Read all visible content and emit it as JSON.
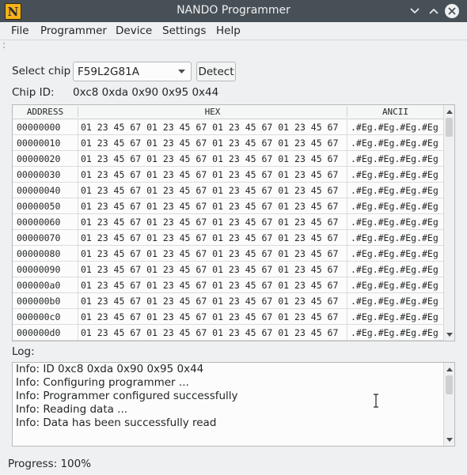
{
  "window": {
    "title": "NANDO Programmer",
    "app_icon_letter": "N"
  },
  "menu": [
    "File",
    "Programmer",
    "Device",
    "Settings",
    "Help"
  ],
  "chip_select": {
    "label": "Select chip",
    "value": "F59L2G81A",
    "detect_label": "Detect"
  },
  "chip_id": {
    "label": "Chip ID:",
    "value": "0xc8 0xda 0x90 0x95 0x44"
  },
  "hex_table": {
    "headers": [
      "ADDRESS",
      "HEX",
      "ANCII"
    ],
    "rows": [
      {
        "address": "00000000",
        "hex": "01 23 45 67 01 23 45 67 01 23 45 67 01 23 45 67",
        "ascii": ".#Eg.#Eg.#Eg.#Eg"
      },
      {
        "address": "00000010",
        "hex": "01 23 45 67 01 23 45 67 01 23 45 67 01 23 45 67",
        "ascii": ".#Eg.#Eg.#Eg.#Eg"
      },
      {
        "address": "00000020",
        "hex": "01 23 45 67 01 23 45 67 01 23 45 67 01 23 45 67",
        "ascii": ".#Eg.#Eg.#Eg.#Eg"
      },
      {
        "address": "00000030",
        "hex": "01 23 45 67 01 23 45 67 01 23 45 67 01 23 45 67",
        "ascii": ".#Eg.#Eg.#Eg.#Eg"
      },
      {
        "address": "00000040",
        "hex": "01 23 45 67 01 23 45 67 01 23 45 67 01 23 45 67",
        "ascii": ".#Eg.#Eg.#Eg.#Eg"
      },
      {
        "address": "00000050",
        "hex": "01 23 45 67 01 23 45 67 01 23 45 67 01 23 45 67",
        "ascii": ".#Eg.#Eg.#Eg.#Eg"
      },
      {
        "address": "00000060",
        "hex": "01 23 45 67 01 23 45 67 01 23 45 67 01 23 45 67",
        "ascii": ".#Eg.#Eg.#Eg.#Eg"
      },
      {
        "address": "00000070",
        "hex": "01 23 45 67 01 23 45 67 01 23 45 67 01 23 45 67",
        "ascii": ".#Eg.#Eg.#Eg.#Eg"
      },
      {
        "address": "00000080",
        "hex": "01 23 45 67 01 23 45 67 01 23 45 67 01 23 45 67",
        "ascii": ".#Eg.#Eg.#Eg.#Eg"
      },
      {
        "address": "00000090",
        "hex": "01 23 45 67 01 23 45 67 01 23 45 67 01 23 45 67",
        "ascii": ".#Eg.#Eg.#Eg.#Eg"
      },
      {
        "address": "000000a0",
        "hex": "01 23 45 67 01 23 45 67 01 23 45 67 01 23 45 67",
        "ascii": ".#Eg.#Eg.#Eg.#Eg"
      },
      {
        "address": "000000b0",
        "hex": "01 23 45 67 01 23 45 67 01 23 45 67 01 23 45 67",
        "ascii": ".#Eg.#Eg.#Eg.#Eg"
      },
      {
        "address": "000000c0",
        "hex": "01 23 45 67 01 23 45 67 01 23 45 67 01 23 45 67",
        "ascii": ".#Eg.#Eg.#Eg.#Eg"
      },
      {
        "address": "000000d0",
        "hex": "01 23 45 67 01 23 45 67 01 23 45 67 01 23 45 67",
        "ascii": ".#Eg.#Eg.#Eg.#Eg"
      }
    ]
  },
  "log": {
    "label": "Log:",
    "lines": [
      "Info: ID 0xc8 0xda 0x90 0x95 0x44",
      "Info: Configuring programmer ...",
      "Info: Programmer configured successfully",
      "Info: Reading data ...",
      "Info: Data has been successfully read"
    ]
  },
  "status": {
    "progress_text": "Progress: 100%",
    "progress": 100
  }
}
